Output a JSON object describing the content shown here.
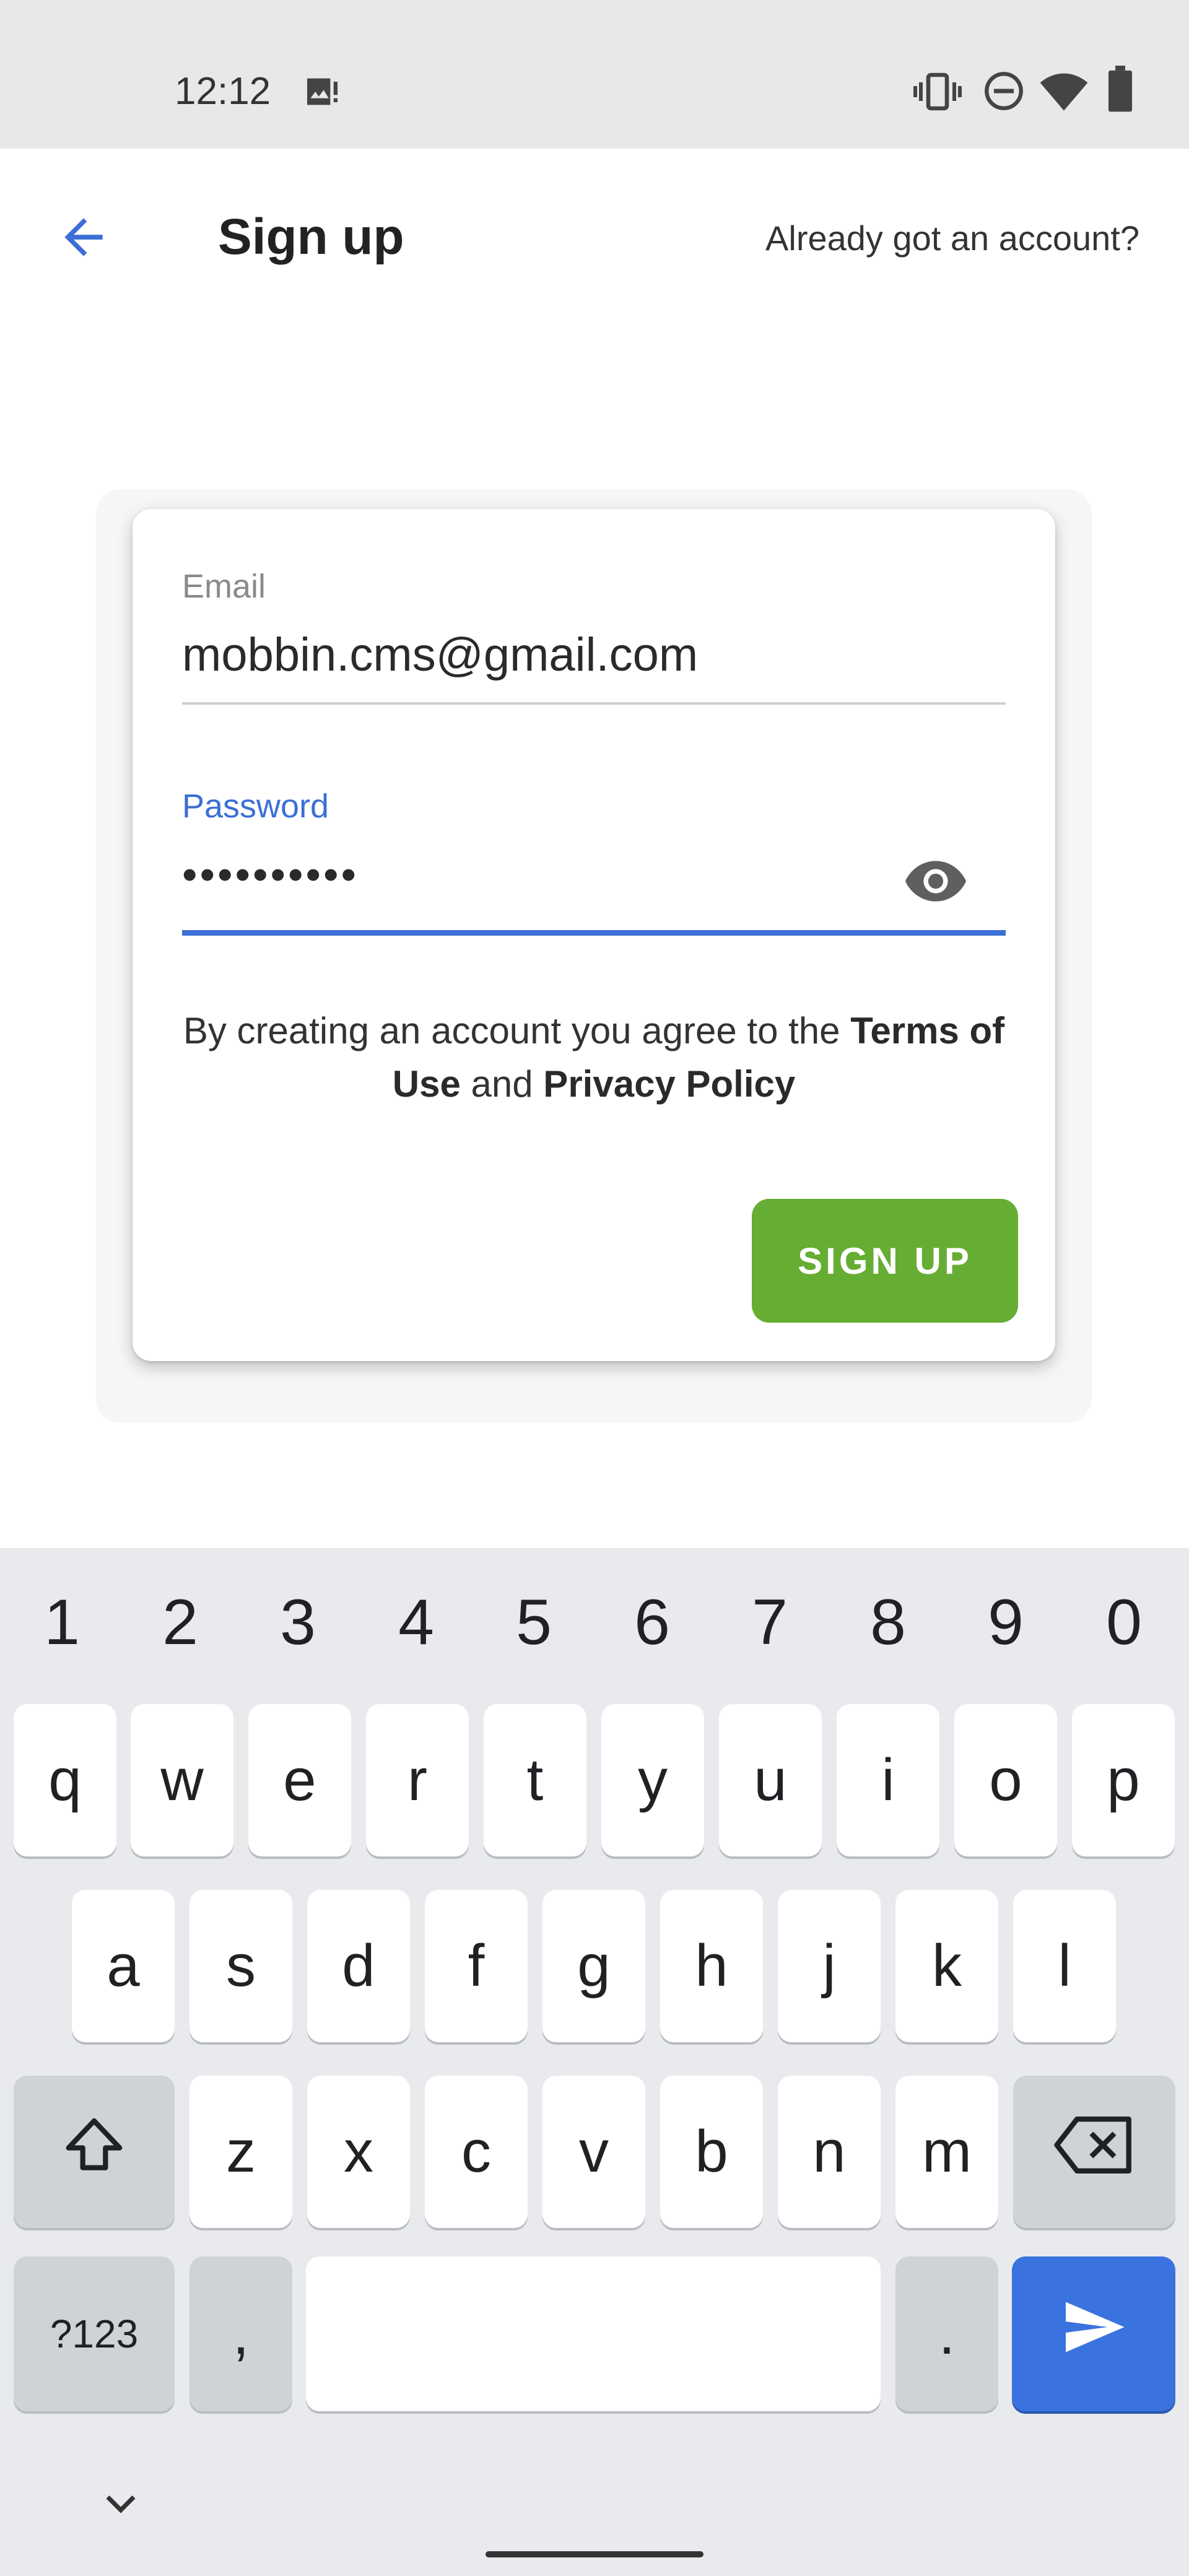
{
  "status_bar": {
    "time": "12:12"
  },
  "app_bar": {
    "title": "Sign up",
    "already_link": "Already got an account?"
  },
  "form": {
    "email_label": "Email",
    "email_value": "mobbin.cms@gmail.com",
    "password_label": "Password",
    "password_masked": "••••••••••",
    "terms_prefix": "By creating an account you agree to the ",
    "terms_link": "Terms of Use",
    "terms_and": " and ",
    "privacy_link": "Privacy Policy",
    "signup_button": "SIGN UP"
  },
  "colors": {
    "accent_blue": "#3b6fd6",
    "signup_green": "#66ad34",
    "keyboard_bg": "#e8eaed"
  },
  "icons": {
    "back": "arrow-left-icon",
    "eye": "eye-icon",
    "shift": "shift-icon",
    "backspace": "backspace-icon",
    "enter": "send-icon",
    "collapse": "chevron-down-icon"
  },
  "keyboard": {
    "numbers": [
      "1",
      "2",
      "3",
      "4",
      "5",
      "6",
      "7",
      "8",
      "9",
      "0"
    ],
    "row1": [
      "q",
      "w",
      "e",
      "r",
      "t",
      "y",
      "u",
      "i",
      "o",
      "p"
    ],
    "row2": [
      "a",
      "s",
      "d",
      "f",
      "g",
      "h",
      "j",
      "k",
      "l"
    ],
    "row3": [
      "z",
      "x",
      "c",
      "v",
      "b",
      "n",
      "m"
    ],
    "symbols_key": "?123",
    "comma_key": ",",
    "period_key": "."
  }
}
